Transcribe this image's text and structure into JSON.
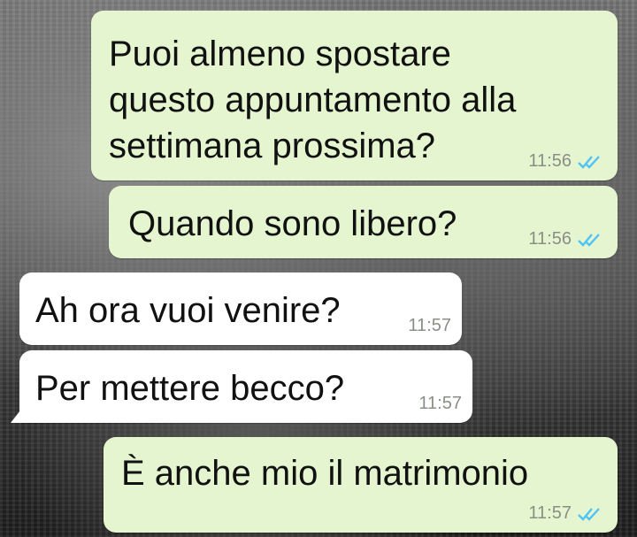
{
  "theme": {
    "outgoing_bubble": "#e4f5cf",
    "incoming_bubble": "#ffffff",
    "read_ticks": "#4fc3f7"
  },
  "messages": [
    {
      "direction": "outgoing",
      "lines": [
        "Puoi almeno spostare",
        "questo appuntamento alla",
        "settimana prossima?"
      ],
      "time": "11:56",
      "status_icon": "double-check-icon"
    },
    {
      "direction": "outgoing",
      "lines": [
        "Quando sono libero?"
      ],
      "time": "11:56",
      "status_icon": "double-check-icon"
    },
    {
      "direction": "incoming",
      "lines": [
        "Ah ora vuoi venire?"
      ],
      "time": "11:57"
    },
    {
      "direction": "incoming",
      "lines": [
        "Per mettere becco?"
      ],
      "time": "11:57"
    },
    {
      "direction": "outgoing",
      "lines": [
        "È anche mio il matrimonio"
      ],
      "time": "11:57",
      "status_icon": "double-check-icon"
    }
  ]
}
